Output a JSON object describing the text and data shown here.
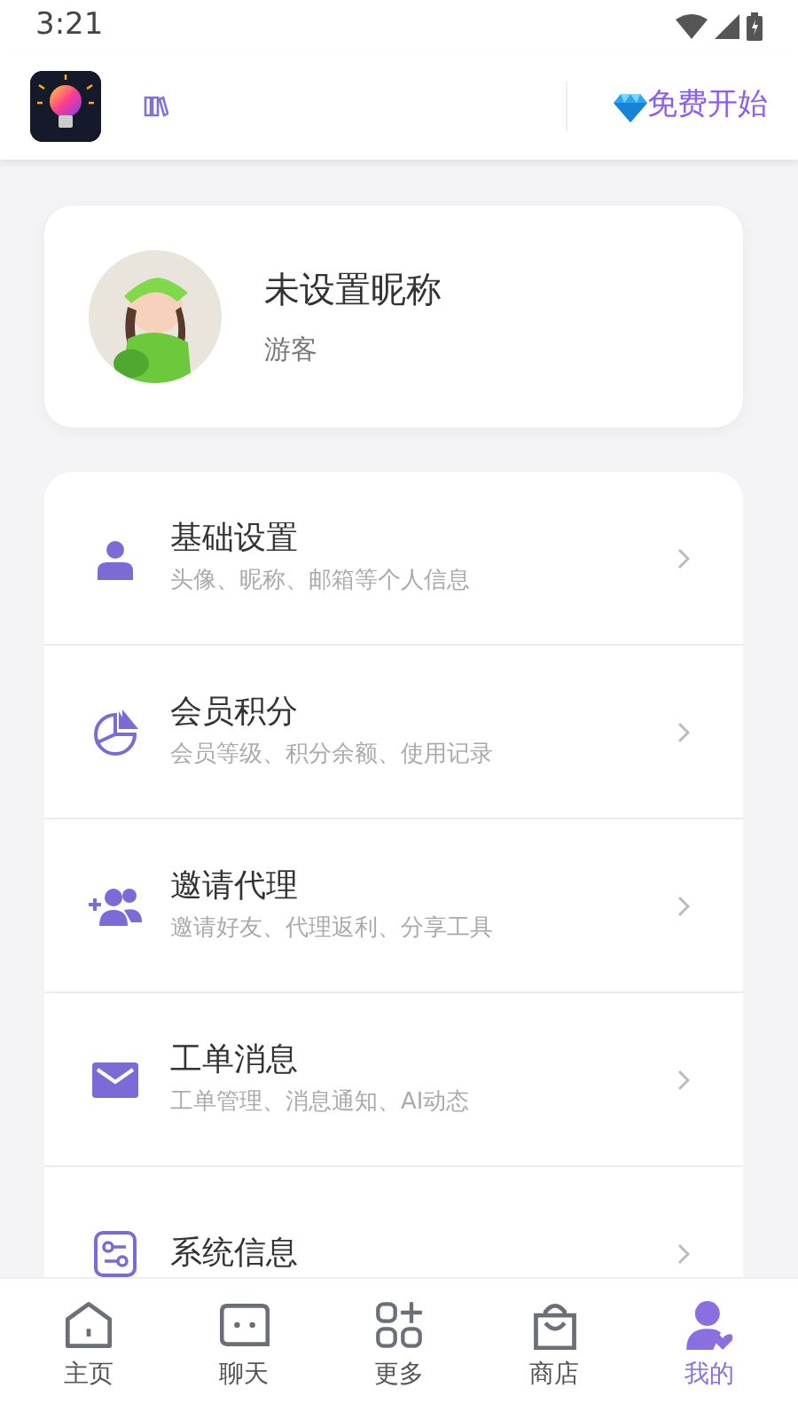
{
  "status_bar": {
    "time": "3:21"
  },
  "header": {
    "cta": "免费开始"
  },
  "profile": {
    "nickname": "未设置昵称",
    "role": "游客"
  },
  "menu": [
    {
      "kind": "person",
      "title": "基础设置",
      "subtitle": "头像、昵称、邮箱等个人信息"
    },
    {
      "kind": "chart",
      "title": "会员积分",
      "subtitle": "会员等级、积分余额、使用记录"
    },
    {
      "kind": "invite",
      "title": "邀请代理",
      "subtitle": "邀请好友、代理返利、分享工具"
    },
    {
      "kind": "mail",
      "title": "工单消息",
      "subtitle": "工单管理、消息通知、AI动态"
    },
    {
      "kind": "system",
      "title": "系统信息"
    }
  ],
  "tabs": [
    {
      "kind": "home",
      "label": "主页",
      "selected": false
    },
    {
      "kind": "chat",
      "label": "聊天",
      "selected": false
    },
    {
      "kind": "more",
      "label": "更多",
      "selected": false
    },
    {
      "kind": "shop",
      "label": "商店",
      "selected": false
    },
    {
      "kind": "me",
      "label": "我的",
      "selected": true
    }
  ]
}
